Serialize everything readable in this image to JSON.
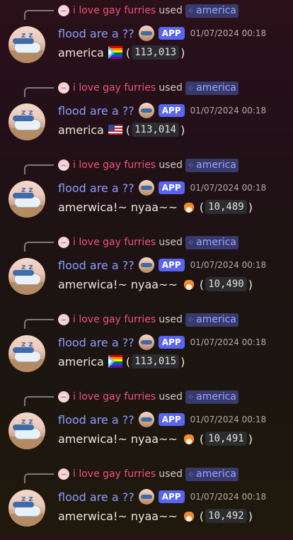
{
  "messages": [
    {
      "reply_user": "i love gay furries",
      "reply_used": "used",
      "command": "america",
      "username": "flood are a ??",
      "app_tag": "APP",
      "timestamp": "01/07/2024 00:18",
      "text": "america",
      "emoji": "pride-flag-icon",
      "open": "(",
      "count": "113,013",
      "close": ")"
    },
    {
      "reply_user": "i love gay furries",
      "reply_used": "used",
      "command": "america",
      "username": "flood are a ??",
      "app_tag": "APP",
      "timestamp": "01/07/2024 00:18",
      "text": "america",
      "emoji": "us-flag-icon",
      "open": "(",
      "count": "113,014",
      "close": ")"
    },
    {
      "reply_user": "i love gay furries",
      "reply_used": "used",
      "command": "america",
      "username": "flood are a ??",
      "app_tag": "APP",
      "timestamp": "01/07/2024 00:18",
      "text": "amerwica!~ nyaa~~",
      "emoji": "fox-icon",
      "open": "(",
      "count": "10,489",
      "close": ")"
    },
    {
      "reply_user": "i love gay furries",
      "reply_used": "used",
      "command": "america",
      "username": "flood are a ??",
      "app_tag": "APP",
      "timestamp": "01/07/2024 00:18",
      "text": "amerwica!~ nyaa~~",
      "emoji": "fox-icon",
      "open": "(",
      "count": "10,490",
      "close": ")"
    },
    {
      "reply_user": "i love gay furries",
      "reply_used": "used",
      "command": "america",
      "username": "flood are a ??",
      "app_tag": "APP",
      "timestamp": "01/07/2024 00:18",
      "text": "america",
      "emoji": "pride-flag-icon",
      "open": "(",
      "count": "113,015",
      "close": ")"
    },
    {
      "reply_user": "i love gay furries",
      "reply_used": "used",
      "command": "america",
      "username": "flood are a ??",
      "app_tag": "APP",
      "timestamp": "01/07/2024 00:18",
      "text": "amerwica!~ nyaa~~",
      "emoji": "fox-icon",
      "open": "(",
      "count": "10,491",
      "close": ")"
    },
    {
      "reply_user": "i love gay furries",
      "reply_used": "used",
      "command": "america",
      "username": "flood are a ??",
      "app_tag": "APP",
      "timestamp": "01/07/2024 00:18",
      "text": "amerwica!~ nyaa~~",
      "emoji": "fox-icon",
      "open": "(",
      "count": "10,492",
      "close": ")"
    }
  ],
  "colors": {
    "reply_user": "#f0517a",
    "username": "#8c9dff",
    "app_tag": "#5865f2",
    "command_chip": "#383a6b"
  }
}
